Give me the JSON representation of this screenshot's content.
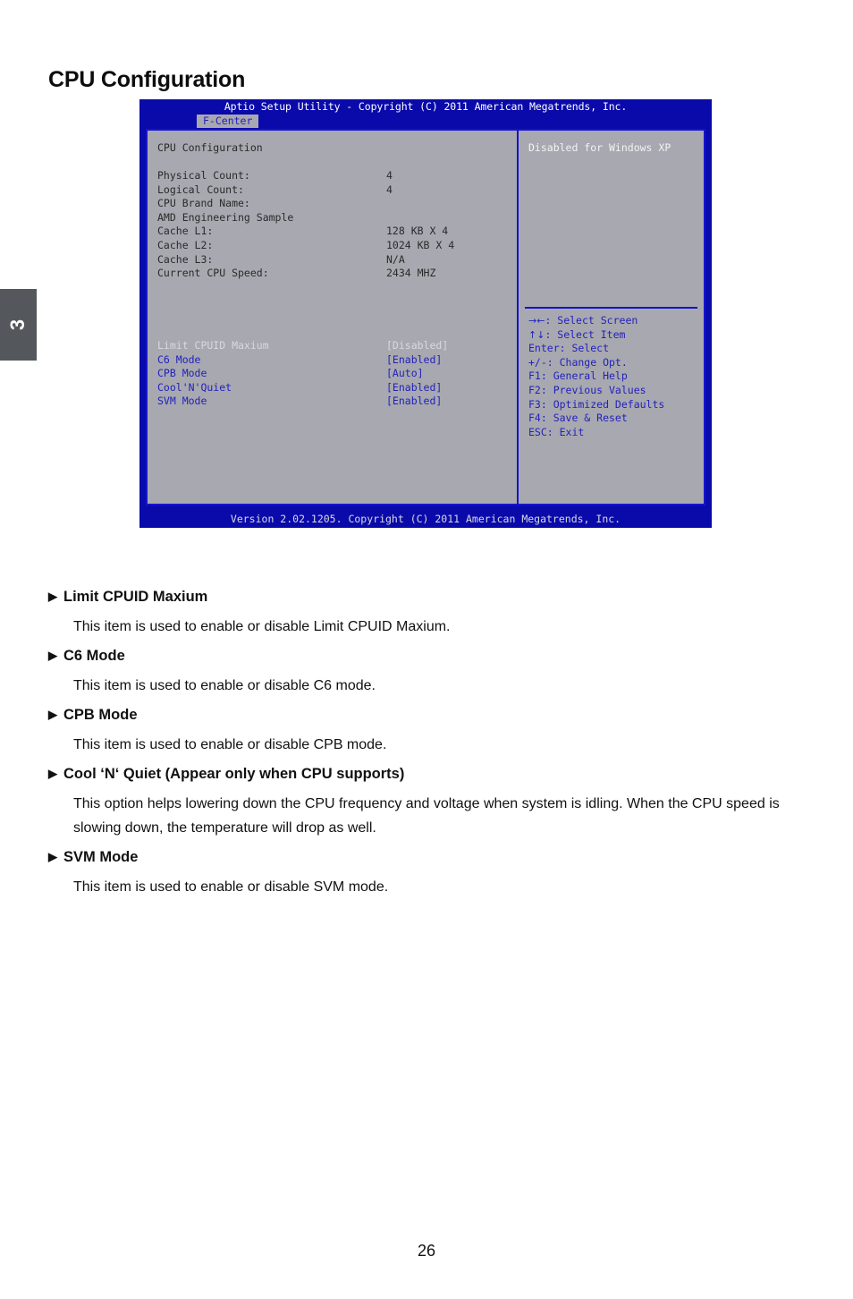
{
  "page": {
    "title": "CPU Configuration",
    "chapter_marker": "3",
    "page_number": "26"
  },
  "bios": {
    "titlebar": "Aptio Setup Utility - Copyright (C) 2011 American Megatrends, Inc.",
    "tab_label": "F-Center",
    "section_title": "CPU Configuration",
    "info_rows": [
      {
        "label": "Physical Count:",
        "value": "4"
      },
      {
        "label": "Logical Count:",
        "value": "4"
      },
      {
        "label": "CPU Brand Name:",
        "value": ""
      },
      {
        "label": "AMD Engineering Sample",
        "value": ""
      },
      {
        "label": "Cache L1:",
        "value": "128 KB X 4"
      },
      {
        "label": "Cache L2:",
        "value": "1024 KB X 4"
      },
      {
        "label": "Cache L3:",
        "value": "N/A"
      },
      {
        "label": "Current CPU Speed:",
        "value": "2434 MHZ"
      }
    ],
    "settings": [
      {
        "label": "Limit CPUID Maxium",
        "value": "[Disabled]",
        "dimmed": true
      },
      {
        "label": "C6 Mode",
        "value": "[Enabled]",
        "dimmed": false
      },
      {
        "label": "CPB Mode",
        "value": "[Auto]",
        "dimmed": false
      },
      {
        "label": "Cool'N'Quiet",
        "value": "[Enabled]",
        "dimmed": false
      },
      {
        "label": "SVM Mode",
        "value": "[Enabled]",
        "dimmed": false
      }
    ],
    "help_text": "Disabled for Windows XP",
    "keys": [
      {
        "glyph": "→←",
        "text": ": Select Screen"
      },
      {
        "glyph": "↑↓",
        "text": ": Select Item"
      },
      {
        "glyph": "",
        "text": "Enter: Select"
      },
      {
        "glyph": "",
        "text": "+/-: Change Opt."
      },
      {
        "glyph": "",
        "text": "F1: General Help"
      },
      {
        "glyph": "",
        "text": "F2: Previous Values"
      },
      {
        "glyph": "",
        "text": "F3: Optimized Defaults"
      },
      {
        "glyph": "",
        "text": "F4: Save & Reset"
      },
      {
        "glyph": "",
        "text": "ESC: Exit"
      }
    ],
    "footer": "Version 2.02.1205. Copyright (C) 2011 American Megatrends, Inc."
  },
  "descriptions": [
    {
      "heading": "Limit CPUID Maxium",
      "paragraphs": [
        "This item is used to enable or disable Limit CPUID Maxium."
      ]
    },
    {
      "heading": "C6 Mode",
      "paragraphs": [
        "This item is used to enable or disable C6 mode."
      ]
    },
    {
      "heading": "CPB Mode",
      "paragraphs": [
        "This item is used to enable or disable CPB mode."
      ]
    },
    {
      "heading": "Cool ‘N‘ Quiet (Appear only when CPU supports)",
      "paragraphs": [
        "This option helps lowering down the CPU frequency and voltage when system is idling. When the CPU speed is slowing down, the temperature will drop as well."
      ]
    },
    {
      "heading": "SVM Mode",
      "paragraphs": [
        "This item is used to enable or disable SVM mode."
      ]
    }
  ],
  "colors": {
    "bios_blue": "#0a0aab",
    "panel_gray": "#a8a8b0",
    "border_blue": "#1414cc",
    "setting_blue": "#2222bb",
    "dim_gray": "#d8d8dd",
    "tab_dark": "#54585c"
  },
  "arrow_bullet": "▶"
}
